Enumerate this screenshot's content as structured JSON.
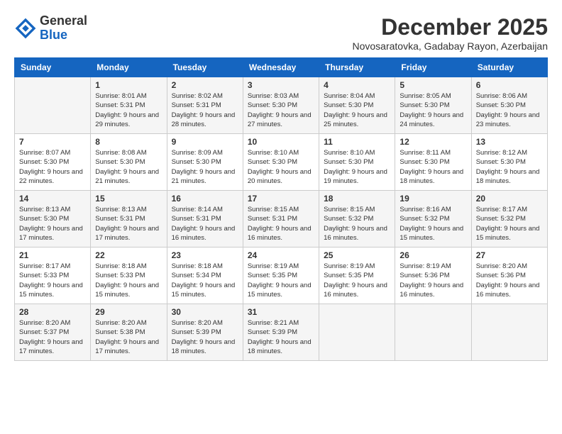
{
  "header": {
    "logo_general": "General",
    "logo_blue": "Blue",
    "month_title": "December 2025",
    "location": "Novosaratovka, Gadabay Rayon, Azerbaijan"
  },
  "days_of_week": [
    "Sunday",
    "Monday",
    "Tuesday",
    "Wednesday",
    "Thursday",
    "Friday",
    "Saturday"
  ],
  "weeks": [
    [
      {
        "day": "",
        "sunrise": "",
        "sunset": "",
        "daylight": ""
      },
      {
        "day": "1",
        "sunrise": "Sunrise: 8:01 AM",
        "sunset": "Sunset: 5:31 PM",
        "daylight": "Daylight: 9 hours and 29 minutes."
      },
      {
        "day": "2",
        "sunrise": "Sunrise: 8:02 AM",
        "sunset": "Sunset: 5:31 PM",
        "daylight": "Daylight: 9 hours and 28 minutes."
      },
      {
        "day": "3",
        "sunrise": "Sunrise: 8:03 AM",
        "sunset": "Sunset: 5:30 PM",
        "daylight": "Daylight: 9 hours and 27 minutes."
      },
      {
        "day": "4",
        "sunrise": "Sunrise: 8:04 AM",
        "sunset": "Sunset: 5:30 PM",
        "daylight": "Daylight: 9 hours and 25 minutes."
      },
      {
        "day": "5",
        "sunrise": "Sunrise: 8:05 AM",
        "sunset": "Sunset: 5:30 PM",
        "daylight": "Daylight: 9 hours and 24 minutes."
      },
      {
        "day": "6",
        "sunrise": "Sunrise: 8:06 AM",
        "sunset": "Sunset: 5:30 PM",
        "daylight": "Daylight: 9 hours and 23 minutes."
      }
    ],
    [
      {
        "day": "7",
        "sunrise": "Sunrise: 8:07 AM",
        "sunset": "Sunset: 5:30 PM",
        "daylight": "Daylight: 9 hours and 22 minutes."
      },
      {
        "day": "8",
        "sunrise": "Sunrise: 8:08 AM",
        "sunset": "Sunset: 5:30 PM",
        "daylight": "Daylight: 9 hours and 21 minutes."
      },
      {
        "day": "9",
        "sunrise": "Sunrise: 8:09 AM",
        "sunset": "Sunset: 5:30 PM",
        "daylight": "Daylight: 9 hours and 21 minutes."
      },
      {
        "day": "10",
        "sunrise": "Sunrise: 8:10 AM",
        "sunset": "Sunset: 5:30 PM",
        "daylight": "Daylight: 9 hours and 20 minutes."
      },
      {
        "day": "11",
        "sunrise": "Sunrise: 8:10 AM",
        "sunset": "Sunset: 5:30 PM",
        "daylight": "Daylight: 9 hours and 19 minutes."
      },
      {
        "day": "12",
        "sunrise": "Sunrise: 8:11 AM",
        "sunset": "Sunset: 5:30 PM",
        "daylight": "Daylight: 9 hours and 18 minutes."
      },
      {
        "day": "13",
        "sunrise": "Sunrise: 8:12 AM",
        "sunset": "Sunset: 5:30 PM",
        "daylight": "Daylight: 9 hours and 18 minutes."
      }
    ],
    [
      {
        "day": "14",
        "sunrise": "Sunrise: 8:13 AM",
        "sunset": "Sunset: 5:30 PM",
        "daylight": "Daylight: 9 hours and 17 minutes."
      },
      {
        "day": "15",
        "sunrise": "Sunrise: 8:13 AM",
        "sunset": "Sunset: 5:31 PM",
        "daylight": "Daylight: 9 hours and 17 minutes."
      },
      {
        "day": "16",
        "sunrise": "Sunrise: 8:14 AM",
        "sunset": "Sunset: 5:31 PM",
        "daylight": "Daylight: 9 hours and 16 minutes."
      },
      {
        "day": "17",
        "sunrise": "Sunrise: 8:15 AM",
        "sunset": "Sunset: 5:31 PM",
        "daylight": "Daylight: 9 hours and 16 minutes."
      },
      {
        "day": "18",
        "sunrise": "Sunrise: 8:15 AM",
        "sunset": "Sunset: 5:32 PM",
        "daylight": "Daylight: 9 hours and 16 minutes."
      },
      {
        "day": "19",
        "sunrise": "Sunrise: 8:16 AM",
        "sunset": "Sunset: 5:32 PM",
        "daylight": "Daylight: 9 hours and 15 minutes."
      },
      {
        "day": "20",
        "sunrise": "Sunrise: 8:17 AM",
        "sunset": "Sunset: 5:32 PM",
        "daylight": "Daylight: 9 hours and 15 minutes."
      }
    ],
    [
      {
        "day": "21",
        "sunrise": "Sunrise: 8:17 AM",
        "sunset": "Sunset: 5:33 PM",
        "daylight": "Daylight: 9 hours and 15 minutes."
      },
      {
        "day": "22",
        "sunrise": "Sunrise: 8:18 AM",
        "sunset": "Sunset: 5:33 PM",
        "daylight": "Daylight: 9 hours and 15 minutes."
      },
      {
        "day": "23",
        "sunrise": "Sunrise: 8:18 AM",
        "sunset": "Sunset: 5:34 PM",
        "daylight": "Daylight: 9 hours and 15 minutes."
      },
      {
        "day": "24",
        "sunrise": "Sunrise: 8:19 AM",
        "sunset": "Sunset: 5:35 PM",
        "daylight": "Daylight: 9 hours and 15 minutes."
      },
      {
        "day": "25",
        "sunrise": "Sunrise: 8:19 AM",
        "sunset": "Sunset: 5:35 PM",
        "daylight": "Daylight: 9 hours and 16 minutes."
      },
      {
        "day": "26",
        "sunrise": "Sunrise: 8:19 AM",
        "sunset": "Sunset: 5:36 PM",
        "daylight": "Daylight: 9 hours and 16 minutes."
      },
      {
        "day": "27",
        "sunrise": "Sunrise: 8:20 AM",
        "sunset": "Sunset: 5:36 PM",
        "daylight": "Daylight: 9 hours and 16 minutes."
      }
    ],
    [
      {
        "day": "28",
        "sunrise": "Sunrise: 8:20 AM",
        "sunset": "Sunset: 5:37 PM",
        "daylight": "Daylight: 9 hours and 17 minutes."
      },
      {
        "day": "29",
        "sunrise": "Sunrise: 8:20 AM",
        "sunset": "Sunset: 5:38 PM",
        "daylight": "Daylight: 9 hours and 17 minutes."
      },
      {
        "day": "30",
        "sunrise": "Sunrise: 8:20 AM",
        "sunset": "Sunset: 5:39 PM",
        "daylight": "Daylight: 9 hours and 18 minutes."
      },
      {
        "day": "31",
        "sunrise": "Sunrise: 8:21 AM",
        "sunset": "Sunset: 5:39 PM",
        "daylight": "Daylight: 9 hours and 18 minutes."
      },
      {
        "day": "",
        "sunrise": "",
        "sunset": "",
        "daylight": ""
      },
      {
        "day": "",
        "sunrise": "",
        "sunset": "",
        "daylight": ""
      },
      {
        "day": "",
        "sunrise": "",
        "sunset": "",
        "daylight": ""
      }
    ]
  ]
}
